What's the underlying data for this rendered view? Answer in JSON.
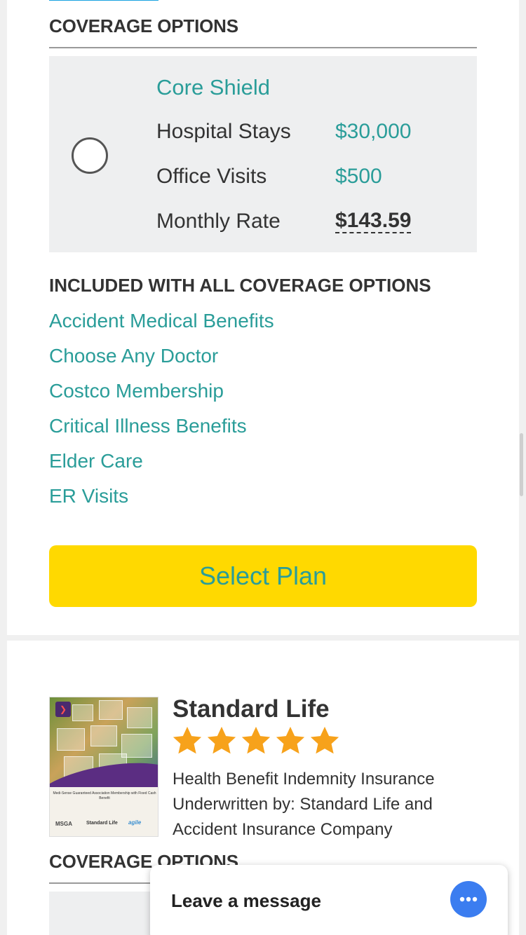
{
  "plan1": {
    "coverage_title": "COVERAGE OPTIONS",
    "option": {
      "name": "Core Shield",
      "rows": [
        {
          "label": "Hospital Stays",
          "value": "$30,000"
        },
        {
          "label": "Office Visits",
          "value": "$500"
        },
        {
          "label": "Monthly Rate",
          "value": "$143.59"
        }
      ]
    },
    "included_title": "INCLUDED WITH ALL COVERAGE OPTIONS",
    "benefits": [
      "Accident Medical Benefits",
      "Choose Any Doctor",
      "Costco Membership",
      "Critical Illness Benefits",
      "Elder Care",
      "ER Visits"
    ],
    "select_label": "Select Plan"
  },
  "plan2": {
    "name": "Standard Life",
    "rating": 5,
    "description": "Health Benefit Indemnity Insurance Underwritten by: Standard Life and Accident Insurance Company",
    "coverage_title": "COVERAGE OPTIONS",
    "brochure": {
      "doc_title": "Medi-Sense Guaranteed Association Membership with Fixed Cash Benefit",
      "logo_left": "MSGA",
      "logo_mid": "Standard Life",
      "logo_right": "agile"
    }
  },
  "chat": {
    "label": "Leave a message"
  },
  "colors": {
    "accent_teal": "#2a9d99",
    "button_yellow": "#ffd900",
    "star_orange": "#f7a21b",
    "chat_blue": "#3b7df0"
  }
}
